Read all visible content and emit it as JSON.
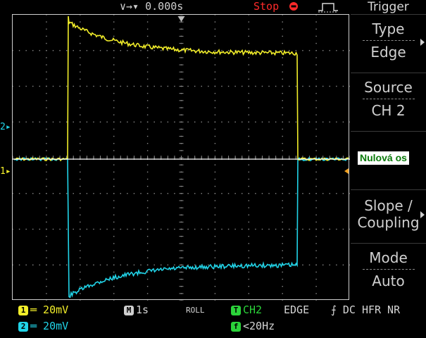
{
  "top": {
    "delay": "∨→▾ 0.000s",
    "run_state": "Stop",
    "trigger_icon": "rising-edge-pulse-icon"
  },
  "markers": {
    "ch2": "2▸",
    "ch1": "1▸"
  },
  "annotation": {
    "zero_axis": "Nulová os"
  },
  "menu": {
    "title": "Trigger",
    "type_label": "Type",
    "type_value": "Edge",
    "source_label": "Source",
    "source_value": "CH 2",
    "slope_label_1": "Slope /",
    "slope_label_2": "Coupling",
    "mode_label": "Mode",
    "mode_value": "Auto"
  },
  "status": {
    "ch1_num": "1",
    "ch1_scale": "═ 20mV",
    "ch2_num": "2",
    "ch2_scale": "═ 20mV",
    "timebase_badge": "M",
    "timebase": "1s",
    "mode": "ROLL",
    "trig_badge": "T",
    "trig_source": "CH2",
    "trig_type": "EDGE",
    "trig_coupling": "⨍ DC HFR NR",
    "freq_badge": "f",
    "freq": "<20Hz"
  },
  "colors": {
    "ch1": "#f2ee2a",
    "ch2": "#21d4e8",
    "trigger": "#2bd43a",
    "stop": "#ff2a2a"
  }
}
